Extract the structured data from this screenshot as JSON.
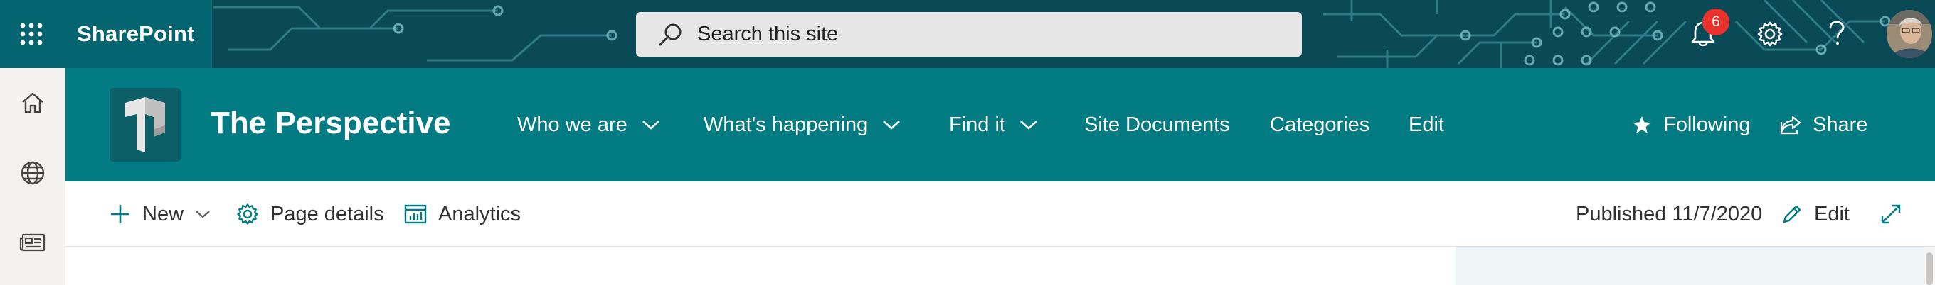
{
  "suite_bar": {
    "app_name": "SharePoint",
    "search_placeholder": "Search this site",
    "notification_count": "6",
    "icons": [
      "app-launcher-icon",
      "search-icon",
      "bell-icon",
      "gear-icon",
      "help-icon",
      "avatar"
    ],
    "colors": {
      "waffle_bg": "#046570",
      "bar_bg": "#0a4a57",
      "badge": "#e8322b",
      "search_bg": "#e6e6e6"
    }
  },
  "app_bar": {
    "items": [
      "home-icon",
      "globe-icon",
      "news-icon"
    ]
  },
  "site_header": {
    "title": "The Perspective",
    "nav": [
      {
        "label": "Who we are",
        "has_dropdown": true
      },
      {
        "label": "What's happening",
        "has_dropdown": true
      },
      {
        "label": "Find it",
        "has_dropdown": true
      },
      {
        "label": "Site Documents",
        "has_dropdown": false
      },
      {
        "label": "Categories",
        "has_dropdown": false
      },
      {
        "label": "Edit",
        "has_dropdown": false
      }
    ],
    "following_label": "Following",
    "share_label": "Share",
    "colors": {
      "header_bg": "#037b82",
      "text": "#ffffff"
    }
  },
  "command_bar": {
    "new_label": "New",
    "page_details_label": "Page details",
    "analytics_label": "Analytics",
    "published_label": "Published 11/7/2020",
    "edit_label": "Edit",
    "colors": {
      "icon_accent": "#037b82"
    }
  }
}
